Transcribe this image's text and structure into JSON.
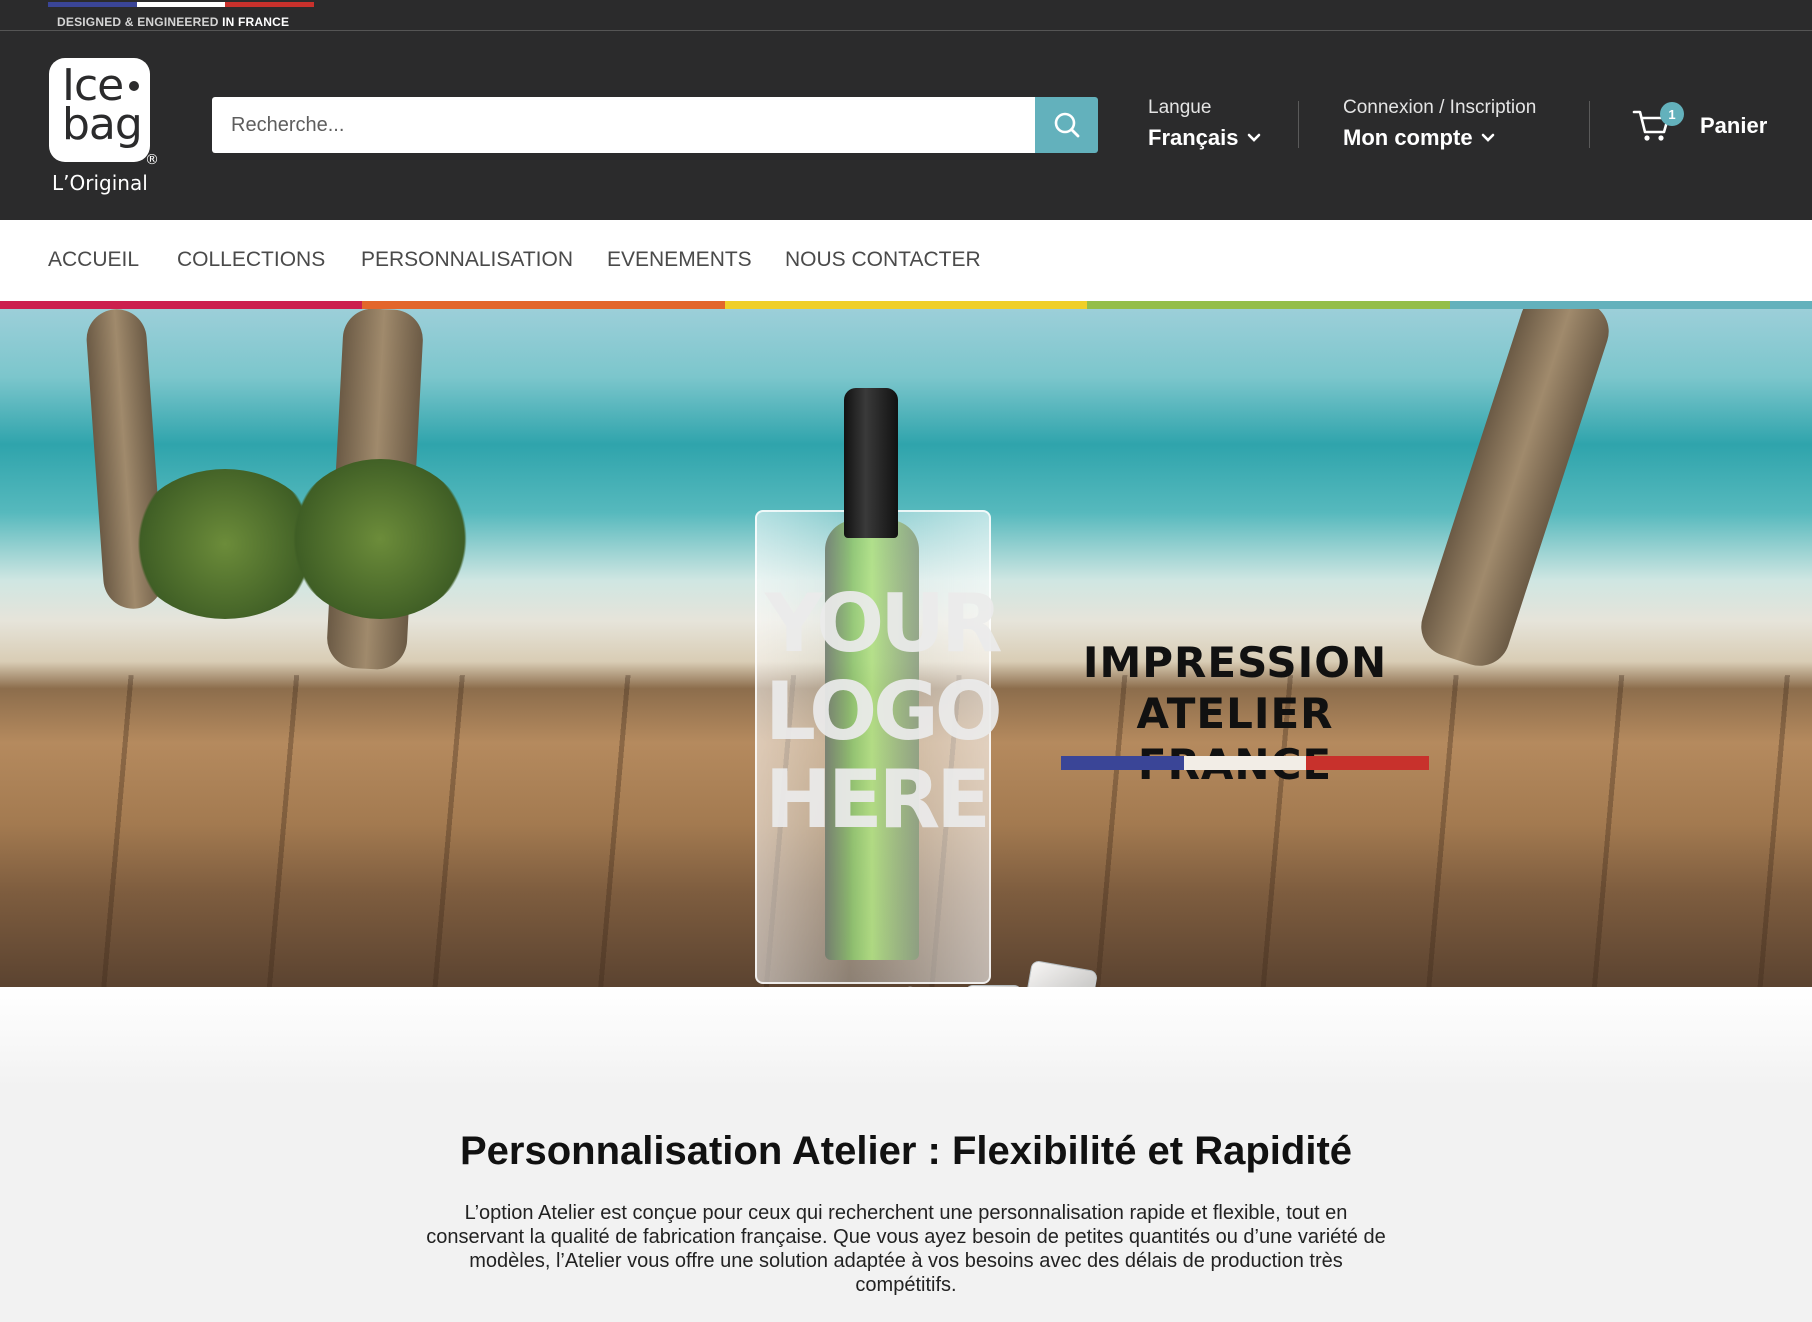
{
  "top_banner": {
    "text_prefix": "DESIGNED & ENGINEERED ",
    "text_suffix": "IN FRANCE",
    "flag_colors": [
      "#3a4597",
      "#ffffff",
      "#c8312c"
    ]
  },
  "header": {
    "logo": {
      "line1": "Ice",
      "line2": "bag",
      "registered": "®",
      "tagline": "L’Original"
    },
    "search": {
      "placeholder": "Recherche...",
      "icon": "search-icon"
    },
    "language": {
      "label": "Langue",
      "value": "Français"
    },
    "account": {
      "label": "Connexion / Inscription",
      "value": "Mon compte"
    },
    "cart": {
      "count": "1",
      "label": "Panier",
      "icon": "cart-icon"
    }
  },
  "nav": {
    "items": [
      "ACCUEIL",
      "COLLECTIONS",
      "PERSONNALISATION",
      "EVENEMENTS",
      "NOUS CONTACTER"
    ]
  },
  "accent_colors": [
    "#cc1f4e",
    "#e3662b",
    "#f0cf28",
    "#94be49",
    "#63b1bc"
  ],
  "hero": {
    "title_line1": "IMPRESSION",
    "title_line2": "ATELIER FRANCE",
    "product_print": {
      "line1": "YOUR",
      "line2": "LOGO",
      "line3": "HERE"
    }
  },
  "content": {
    "title": "Personnalisation Atelier : Flexibilité et Rapidité",
    "body": "L’option Atelier est conçue pour ceux qui recherchent une personnalisation rapide et flexible, tout en conservant la qualité de fabrication française. Que vous ayez besoin de petites quantités ou d’une variété de modèles, l’Atelier vous offre une solution adaptée à vos besoins avec des délais de production très compétitifs."
  }
}
